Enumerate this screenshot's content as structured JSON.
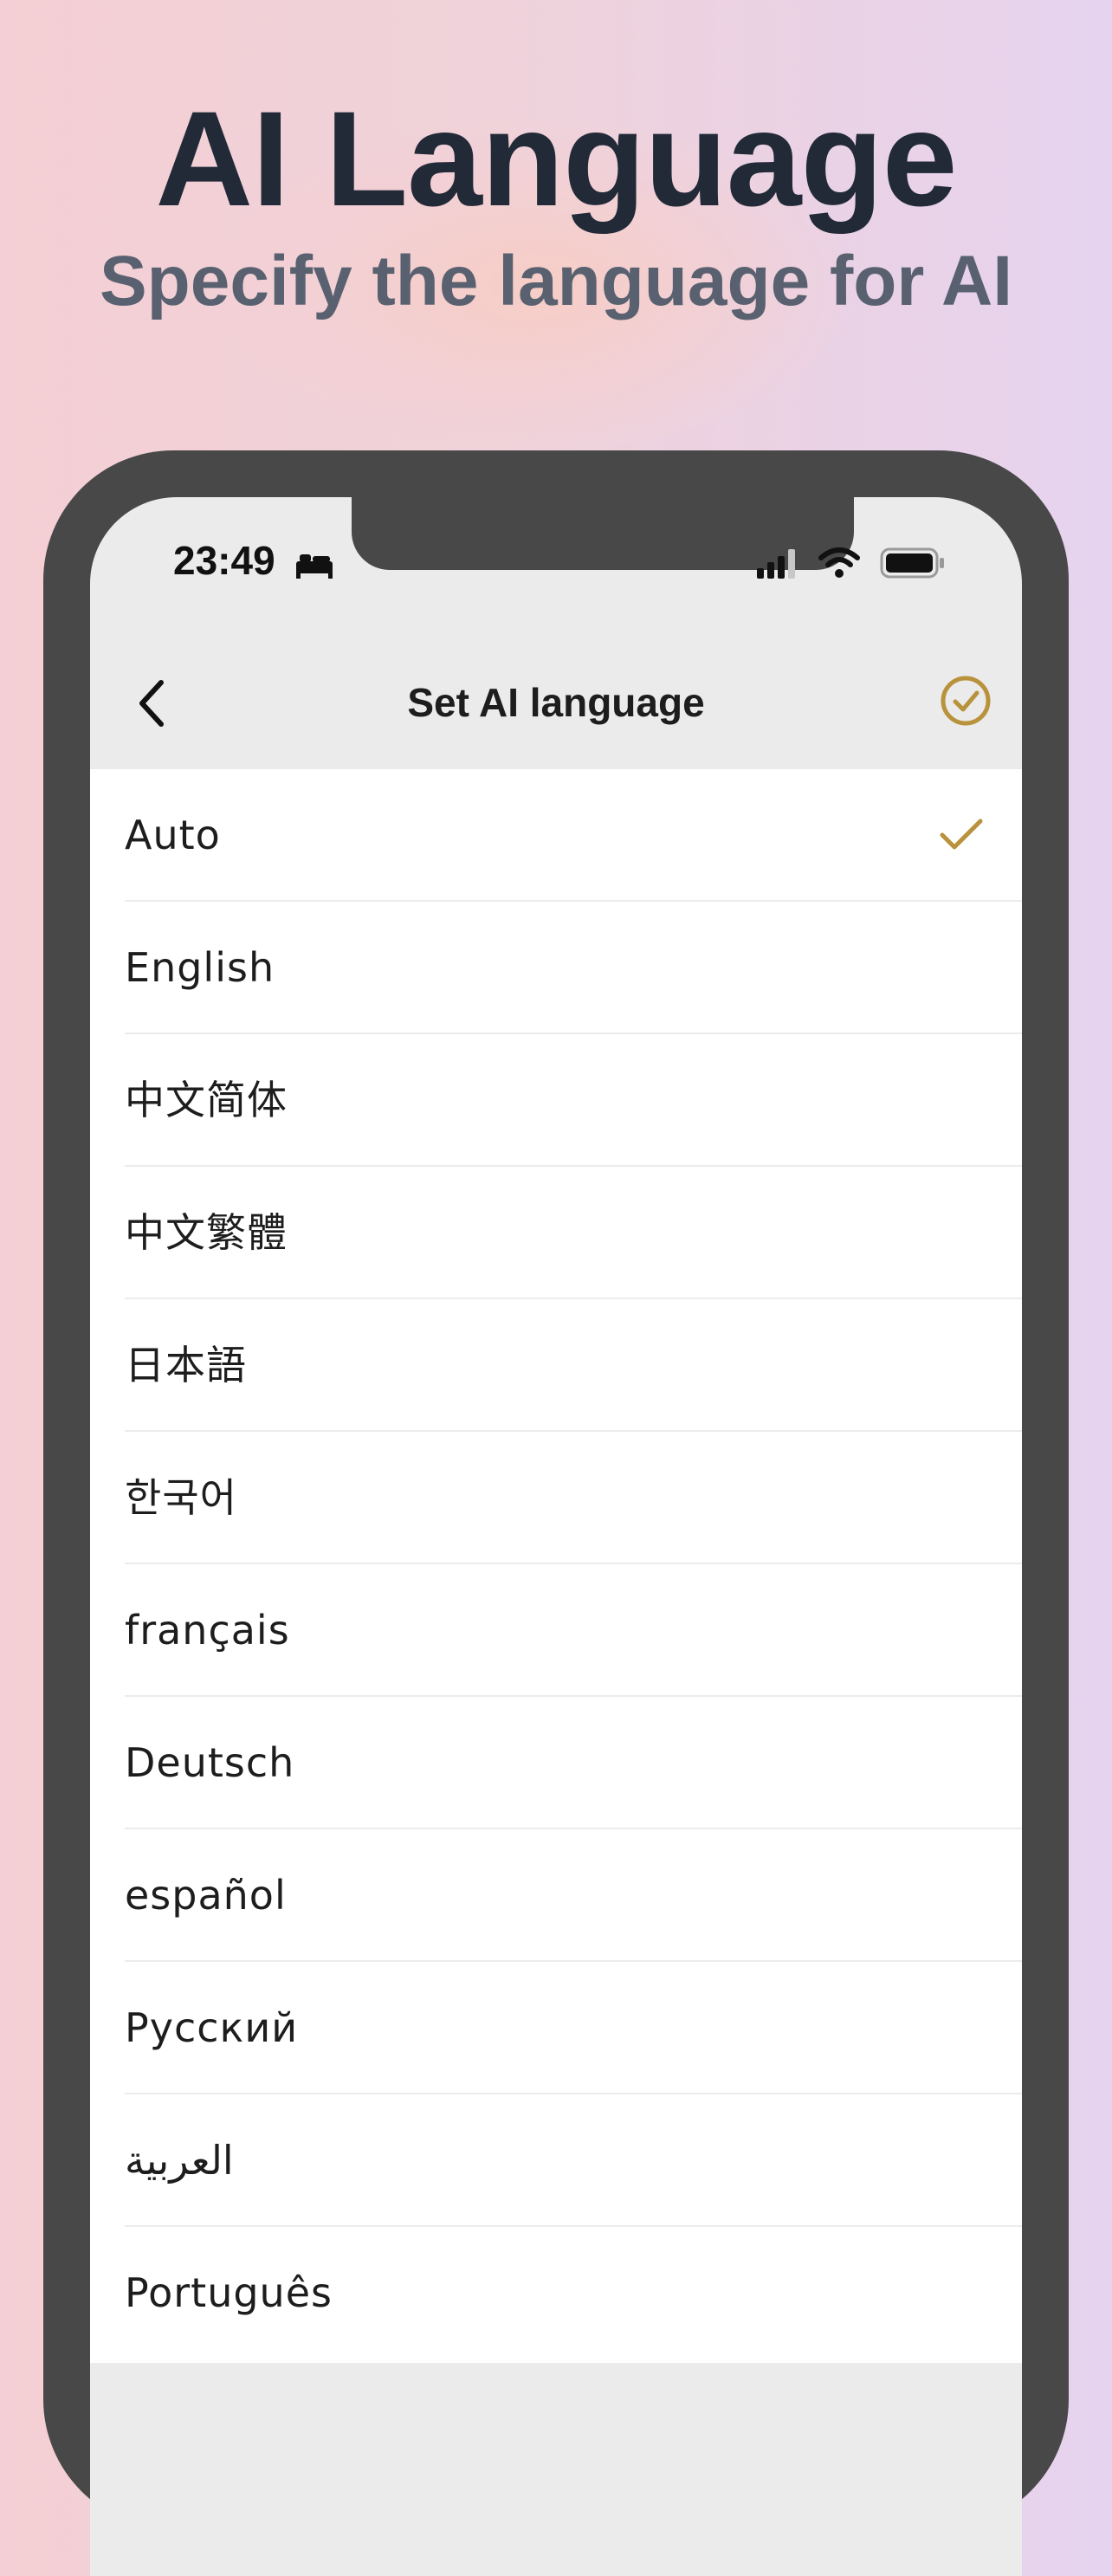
{
  "promo": {
    "title": "AI Language",
    "subtitle": "Specify the language for AI"
  },
  "status_bar": {
    "time": "23:49",
    "icons": [
      "bed-icon",
      "signal-icon",
      "wifi-icon",
      "battery-icon"
    ]
  },
  "nav": {
    "title": "Set AI language",
    "back_icon": "chevron-left-icon",
    "confirm_icon": "check-circle-icon"
  },
  "languages": [
    {
      "label": "Auto",
      "selected": true
    },
    {
      "label": "English",
      "selected": false
    },
    {
      "label": "中文简体",
      "selected": false
    },
    {
      "label": "中文繁體",
      "selected": false
    },
    {
      "label": "日本語",
      "selected": false
    },
    {
      "label": "한국어",
      "selected": false
    },
    {
      "label": "français",
      "selected": false
    },
    {
      "label": "Deutsch",
      "selected": false
    },
    {
      "label": "español",
      "selected": false
    },
    {
      "label": "Русский",
      "selected": false
    },
    {
      "label": "العربية",
      "selected": false
    },
    {
      "label": "Português",
      "selected": false
    }
  ],
  "colors": {
    "accent": "#b8923c",
    "frame": "#484848",
    "headline": "#222a38",
    "subheadline": "#596170"
  }
}
